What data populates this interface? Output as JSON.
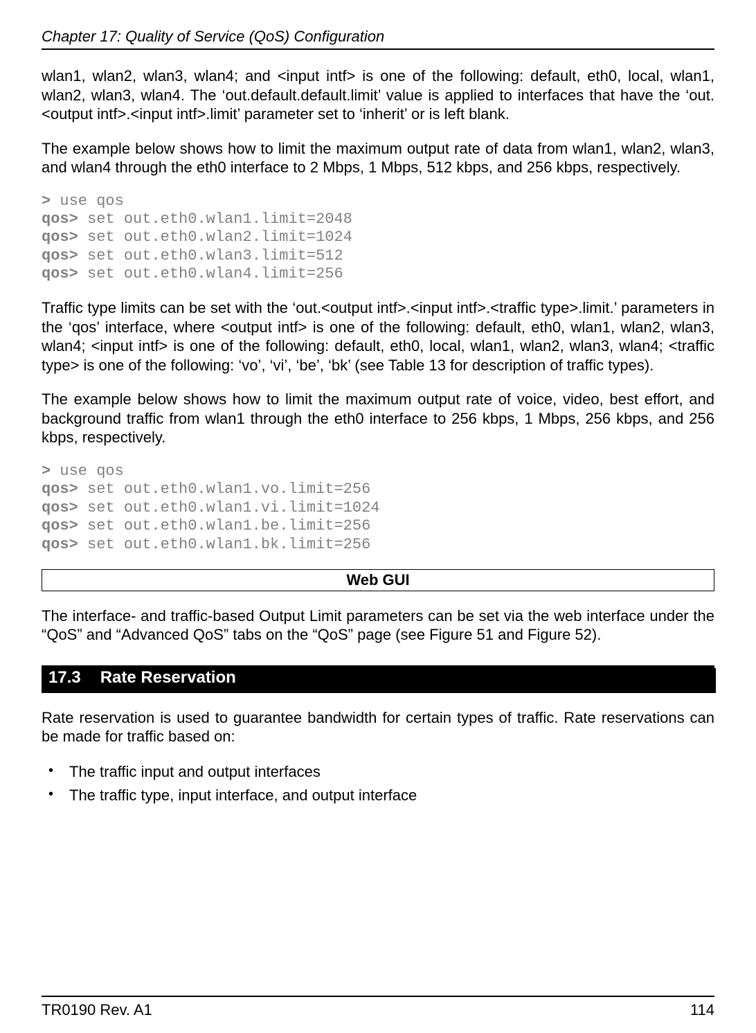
{
  "header": {
    "chapter": "Chapter 17: Quality of Service (QoS) Configuration"
  },
  "para1": "wlan1, wlan2, wlan3, wlan4; and <input intf> is one of the following: default, eth0, local, wlan1, wlan2, wlan3, wlan4. The ‘out.default.default.limit’ value is applied to interfaces that have the ‘out.<output intf>.<input intf>.limit’ parameter set to ‘inherit’ or is left blank.",
  "para2": "The example below shows how to limit the maximum output rate of data from wlan1, wlan2, wlan3, and wlan4 through the eth0 interface to 2 Mbps, 1 Mbps, 512 kbps, and 256 kbps, respectively.",
  "code1": {
    "prompt0": ">",
    "cmd0": " use qos",
    "prompt1": "qos>",
    "cmd1": " set out.eth0.wlan1.limit=2048",
    "prompt2": "qos>",
    "cmd2": " set out.eth0.wlan2.limit=1024",
    "prompt3": "qos>",
    "cmd3": " set out.eth0.wlan3.limit=512",
    "prompt4": "qos>",
    "cmd4": " set out.eth0.wlan4.limit=256"
  },
  "para3": "Traffic type limits can be set with the ‘out.<output intf>.<input intf>.<traffic type>.limit.’ parameters in the ‘qos’ interface, where <output intf> is one of the following: default, eth0, wlan1, wlan2, wlan3, wlan4; <input intf> is one of the following: default, eth0, local, wlan1, wlan2, wlan3, wlan4; <traffic type> is one of the following: ‘vo’, ‘vi’, ‘be’, ‘bk’ (see Table 13 for description of traffic types).",
  "para4": "The example below shows how to limit the maximum output rate of voice, video, best effort, and background traffic from wlan1 through the eth0 interface to 256 kbps, 1 Mbps, 256 kbps, and 256 kbps, respectively.",
  "code2": {
    "prompt0": ">",
    "cmd0": " use qos",
    "prompt1": "qos>",
    "cmd1": " set out.eth0.wlan1.vo.limit=256",
    "prompt2": "qos>",
    "cmd2": " set out.eth0.wlan1.vi.limit=1024",
    "prompt3": "qos>",
    "cmd3": " set out.eth0.wlan1.be.limit=256",
    "prompt4": "qos>",
    "cmd4": " set out.eth0.wlan1.bk.limit=256"
  },
  "webgui": {
    "title": "Web GUI",
    "para": "The interface- and traffic-based Output Limit parameters can be set via the web interface under the “QoS” and “Advanced QoS” tabs on the “QoS” page (see Figure 51 and Figure 52)."
  },
  "section": {
    "num": "17.3",
    "title": "Rate Reservation"
  },
  "para5": "Rate reservation is used to guarantee bandwidth for certain types of traffic. Rate reservations can be made for traffic based on:",
  "bullets": {
    "b1": "The traffic input and output interfaces",
    "b2": "The traffic type, input interface, and output interface"
  },
  "footer": {
    "left": "TR0190 Rev. A1",
    "right": "114"
  }
}
